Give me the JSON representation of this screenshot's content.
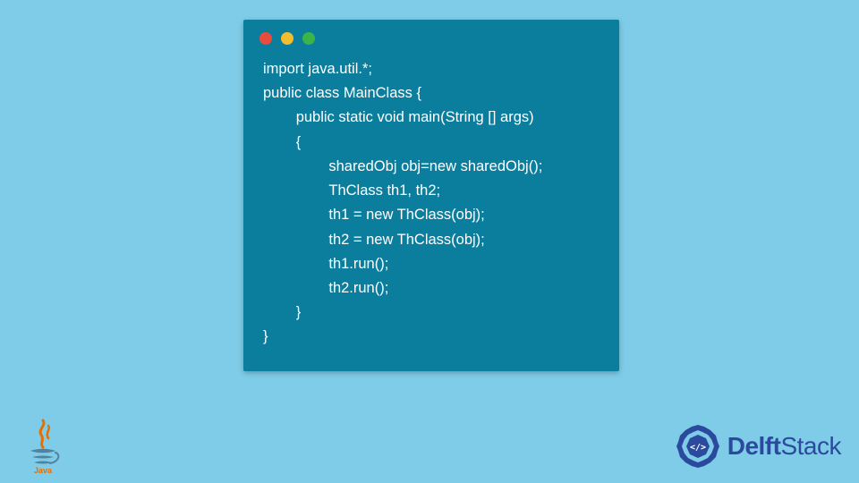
{
  "window": {
    "dots": [
      "red",
      "yellow",
      "green"
    ]
  },
  "code": {
    "lines": [
      "import java.util.*;",
      "public class MainClass {",
      "\tpublic static void main(String [] args)",
      "\t{",
      "\t\tsharedObj obj=new sharedObj();",
      "\t\tThClass th1, th2;",
      "\t\tth1 = new ThClass(obj);",
      "\t\tth2 = new ThClass(obj);",
      "\t\tth1.run();",
      "\t\tth2.run();",
      "\t}",
      "}"
    ]
  },
  "logos": {
    "java_label": "Java",
    "delft_brand": "Delft",
    "delft_suffix": "Stack"
  }
}
